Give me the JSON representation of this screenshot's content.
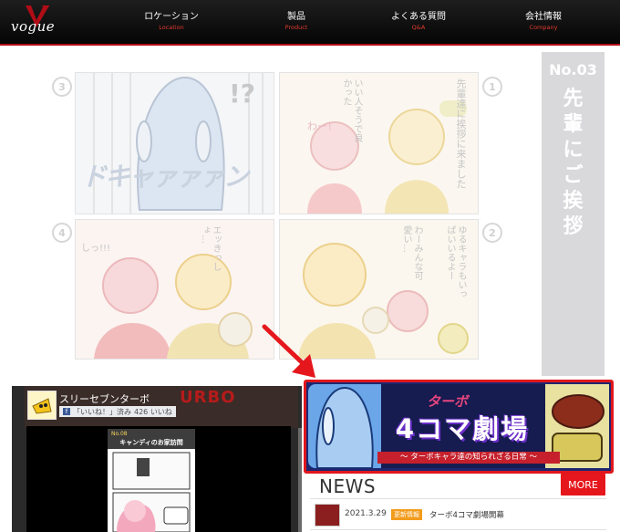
{
  "header": {
    "logo_text": "vogue",
    "nav": [
      {
        "jp": "ロケーション",
        "en": "Location"
      },
      {
        "jp": "製品",
        "en": "Product"
      },
      {
        "jp": "よくある質問",
        "en": "Q&A"
      },
      {
        "jp": "会社情報",
        "en": "Company"
      }
    ]
  },
  "comic": {
    "panel_numbers": [
      "3",
      "1",
      "4",
      "2"
    ],
    "speech": {
      "p1_a": "先輩達に挨拶に来ました",
      "p1_b": "いい人そうで良かった",
      "p1_c": "わー！",
      "p3": "ドキャァァァン",
      "p3_mark": "!?",
      "p2_a": "ゆるキャラもいっぱいいるよー",
      "p2_b": "わーみんな可愛い…",
      "p4_a": "エッきっしょ…",
      "p4_b": "しっ!!!"
    }
  },
  "sidebar": {
    "number": "No.03",
    "title_chars": [
      "先",
      "輩",
      "に",
      "ご",
      "挨",
      "拶"
    ]
  },
  "facebook": {
    "page_name": "スリーセブンターボ",
    "like_label": "「いいね！」済み",
    "like_count": "426 いいね",
    "banner_text": "URBO",
    "manga_no": "No.08",
    "manga_title": "キャンディのお家訪問"
  },
  "banner": {
    "top": "ターボ",
    "main": "4コマ劇場",
    "sub": "〜 ターボキャラ達の知られざる日常 〜"
  },
  "news": {
    "title": "NEWS",
    "more": "MORE",
    "items": [
      {
        "date": "2021.3.29",
        "badge": "更新情報",
        "text": "ターボ4コマ劇場開幕"
      }
    ]
  },
  "colors": {
    "header_bg": "#111111",
    "accent_red": "#e5171c",
    "sidebar_gray": "#d9d9dc",
    "news_badge": "#f29c1c"
  }
}
